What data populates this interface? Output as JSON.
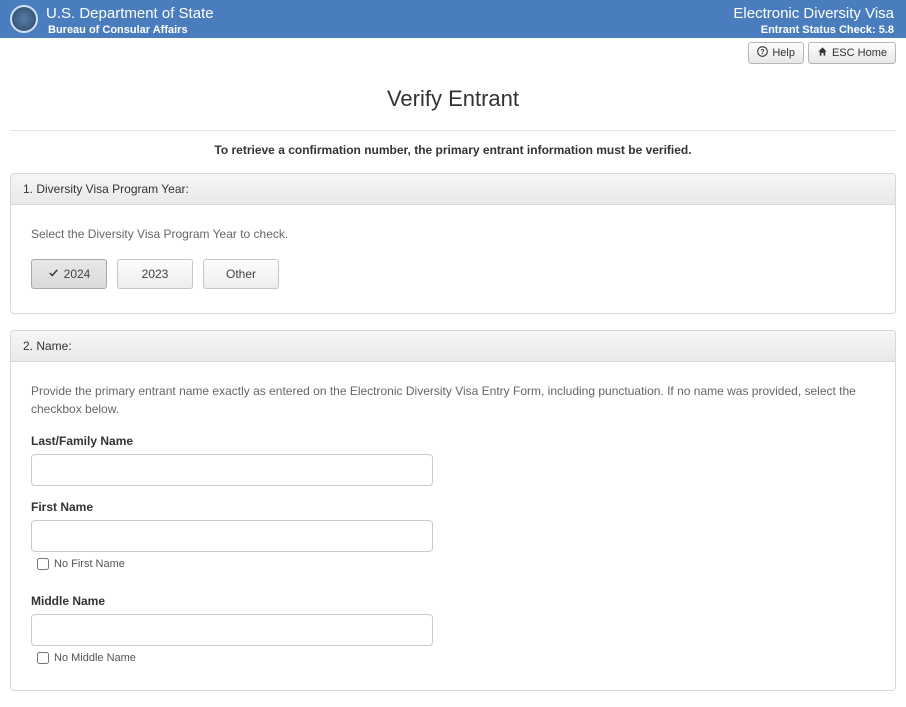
{
  "header": {
    "dept": "U.S. Department of State",
    "bureau": "Bureau of Consular Affairs",
    "app": "Electronic Diversity Visa",
    "version": "Entrant Status Check: 5.8"
  },
  "toolbar": {
    "help": "Help",
    "home": "ESC Home"
  },
  "page": {
    "title": "Verify Entrant",
    "instruction": "To retrieve a confirmation number, the primary entrant information must be verified."
  },
  "section1": {
    "heading": "1. Diversity Visa Program Year:",
    "prompt": "Select the Diversity Visa Program Year to check.",
    "years": {
      "y2024": "2024",
      "y2023": "2023",
      "other": "Other"
    }
  },
  "section2": {
    "heading": "2. Name:",
    "prompt": "Provide the primary entrant name exactly as entered on the Electronic Diversity Visa Entry Form, including punctuation. If no name was provided, select the checkbox below.",
    "last_label": "Last/Family Name",
    "first_label": "First Name",
    "no_first": "No First Name",
    "middle_label": "Middle Name",
    "no_middle": "No Middle Name"
  }
}
